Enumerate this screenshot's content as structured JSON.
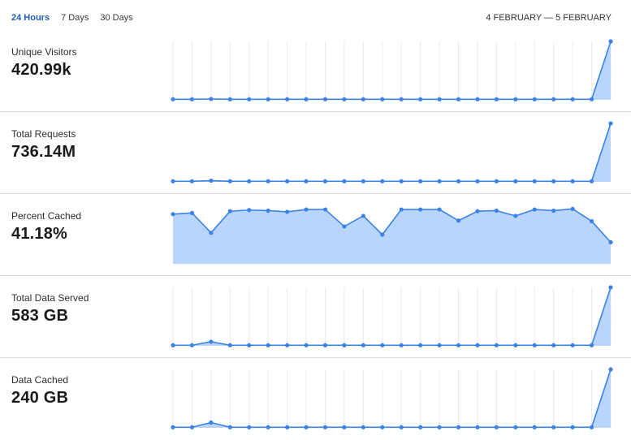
{
  "range_tabs": [
    {
      "label": "24 Hours",
      "active": true
    },
    {
      "label": "7 Days",
      "active": false
    },
    {
      "label": "30 Days",
      "active": false
    }
  ],
  "date_range": "4 FEBRUARY — 5 FEBRUARY",
  "colors": {
    "line": "#3b82e6",
    "fill": "#b9d5fb",
    "gridline": "#e6eaf2",
    "divider": "#d9d9d9",
    "active_tab": "#1e5bb8"
  },
  "metrics": [
    {
      "label": "Unique Visitors",
      "value": "420.99k"
    },
    {
      "label": "Total Requests",
      "value": "736.14M"
    },
    {
      "label": "Percent Cached",
      "value": "41.18%"
    },
    {
      "label": "Total Data Served",
      "value": "583 GB"
    },
    {
      "label": "Data Cached",
      "value": "240 GB"
    }
  ],
  "chart_data": [
    {
      "type": "area",
      "series": [
        {
          "values": [
            1,
            1,
            1.5,
            1,
            1,
            1,
            1,
            1,
            1,
            1,
            1,
            1,
            1,
            1,
            1,
            1,
            1,
            1,
            1,
            1,
            1,
            1,
            1,
            100
          ]
        }
      ],
      "ylim": [
        0,
        100
      ],
      "grid": true
    },
    {
      "type": "area",
      "series": [
        {
          "values": [
            1,
            1,
            2,
            1,
            1,
            1,
            1,
            1,
            1,
            1,
            1,
            1,
            1,
            1,
            1,
            1,
            1,
            1,
            1,
            1,
            1,
            1,
            1,
            100
          ]
        }
      ],
      "ylim": [
        0,
        100
      ],
      "grid": false
    },
    {
      "type": "area",
      "series": [
        {
          "values": [
            85,
            87,
            53,
            90,
            92,
            91,
            89,
            93,
            93,
            64,
            82,
            50,
            93,
            93,
            93,
            74,
            90,
            91,
            82,
            93,
            91,
            94,
            73,
            37
          ]
        }
      ],
      "ylim": [
        0,
        100
      ],
      "grid": false
    },
    {
      "type": "area",
      "series": [
        {
          "values": [
            1,
            1,
            7,
            1,
            1,
            1,
            1,
            1,
            1,
            1,
            1,
            1,
            1,
            1,
            1,
            1,
            1,
            1,
            1,
            1,
            1,
            1,
            1,
            100
          ]
        }
      ],
      "ylim": [
        0,
        100
      ],
      "grid": true
    },
    {
      "type": "area",
      "series": [
        {
          "values": [
            1,
            1,
            9,
            1,
            1,
            1,
            1,
            1,
            1,
            1,
            1,
            1,
            1,
            1,
            1,
            1,
            1,
            1,
            1,
            1,
            1,
            1,
            1,
            100
          ]
        }
      ],
      "ylim": [
        0,
        100
      ],
      "grid": true
    }
  ]
}
